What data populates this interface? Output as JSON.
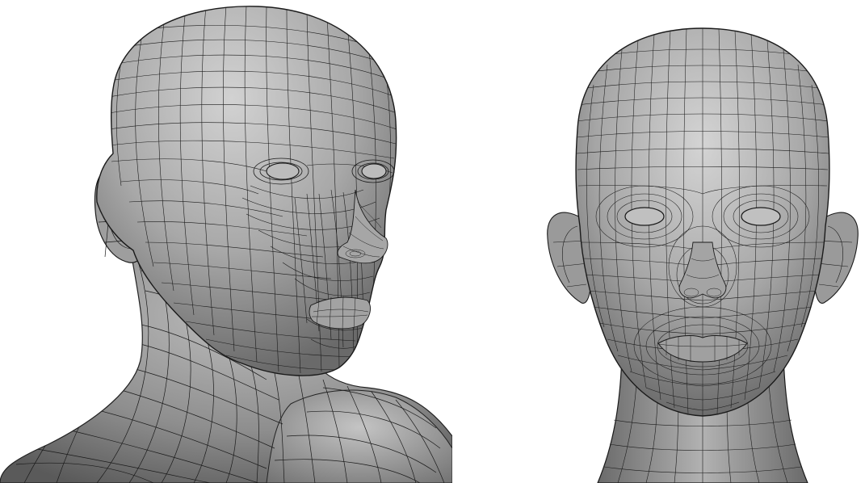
{
  "scene": {
    "views": [
      {
        "id": "three-quarter",
        "subject": "head-mesh-wireframe"
      },
      {
        "id": "front",
        "subject": "head-mesh-wireframe"
      }
    ],
    "colors": {
      "background": "#ffffff",
      "mesh_light": "#c9c9c9",
      "mesh_mid": "#9a9a9a",
      "mesh_dark": "#5e5e5e",
      "wire": "#1a1a1a"
    }
  }
}
